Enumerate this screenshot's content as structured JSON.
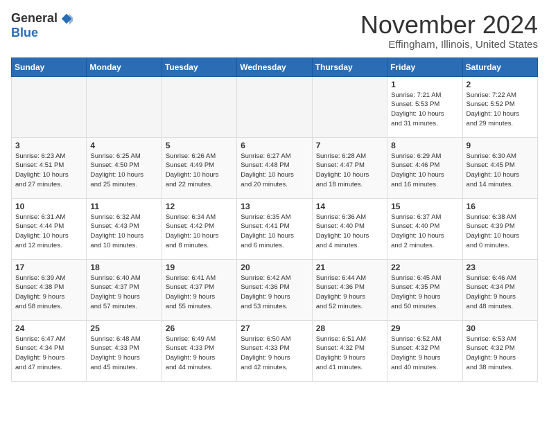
{
  "header": {
    "logo_general": "General",
    "logo_blue": "Blue",
    "month": "November 2024",
    "location": "Effingham, Illinois, United States"
  },
  "weekdays": [
    "Sunday",
    "Monday",
    "Tuesday",
    "Wednesday",
    "Thursday",
    "Friday",
    "Saturday"
  ],
  "weeks": [
    [
      {
        "day": "",
        "info": ""
      },
      {
        "day": "",
        "info": ""
      },
      {
        "day": "",
        "info": ""
      },
      {
        "day": "",
        "info": ""
      },
      {
        "day": "",
        "info": ""
      },
      {
        "day": "1",
        "info": "Sunrise: 7:21 AM\nSunset: 5:53 PM\nDaylight: 10 hours\nand 31 minutes."
      },
      {
        "day": "2",
        "info": "Sunrise: 7:22 AM\nSunset: 5:52 PM\nDaylight: 10 hours\nand 29 minutes."
      }
    ],
    [
      {
        "day": "3",
        "info": "Sunrise: 6:23 AM\nSunset: 4:51 PM\nDaylight: 10 hours\nand 27 minutes."
      },
      {
        "day": "4",
        "info": "Sunrise: 6:25 AM\nSunset: 4:50 PM\nDaylight: 10 hours\nand 25 minutes."
      },
      {
        "day": "5",
        "info": "Sunrise: 6:26 AM\nSunset: 4:49 PM\nDaylight: 10 hours\nand 22 minutes."
      },
      {
        "day": "6",
        "info": "Sunrise: 6:27 AM\nSunset: 4:48 PM\nDaylight: 10 hours\nand 20 minutes."
      },
      {
        "day": "7",
        "info": "Sunrise: 6:28 AM\nSunset: 4:47 PM\nDaylight: 10 hours\nand 18 minutes."
      },
      {
        "day": "8",
        "info": "Sunrise: 6:29 AM\nSunset: 4:46 PM\nDaylight: 10 hours\nand 16 minutes."
      },
      {
        "day": "9",
        "info": "Sunrise: 6:30 AM\nSunset: 4:45 PM\nDaylight: 10 hours\nand 14 minutes."
      }
    ],
    [
      {
        "day": "10",
        "info": "Sunrise: 6:31 AM\nSunset: 4:44 PM\nDaylight: 10 hours\nand 12 minutes."
      },
      {
        "day": "11",
        "info": "Sunrise: 6:32 AM\nSunset: 4:43 PM\nDaylight: 10 hours\nand 10 minutes."
      },
      {
        "day": "12",
        "info": "Sunrise: 6:34 AM\nSunset: 4:42 PM\nDaylight: 10 hours\nand 8 minutes."
      },
      {
        "day": "13",
        "info": "Sunrise: 6:35 AM\nSunset: 4:41 PM\nDaylight: 10 hours\nand 6 minutes."
      },
      {
        "day": "14",
        "info": "Sunrise: 6:36 AM\nSunset: 4:40 PM\nDaylight: 10 hours\nand 4 minutes."
      },
      {
        "day": "15",
        "info": "Sunrise: 6:37 AM\nSunset: 4:40 PM\nDaylight: 10 hours\nand 2 minutes."
      },
      {
        "day": "16",
        "info": "Sunrise: 6:38 AM\nSunset: 4:39 PM\nDaylight: 10 hours\nand 0 minutes."
      }
    ],
    [
      {
        "day": "17",
        "info": "Sunrise: 6:39 AM\nSunset: 4:38 PM\nDaylight: 9 hours\nand 58 minutes."
      },
      {
        "day": "18",
        "info": "Sunrise: 6:40 AM\nSunset: 4:37 PM\nDaylight: 9 hours\nand 57 minutes."
      },
      {
        "day": "19",
        "info": "Sunrise: 6:41 AM\nSunset: 4:37 PM\nDaylight: 9 hours\nand 55 minutes."
      },
      {
        "day": "20",
        "info": "Sunrise: 6:42 AM\nSunset: 4:36 PM\nDaylight: 9 hours\nand 53 minutes."
      },
      {
        "day": "21",
        "info": "Sunrise: 6:44 AM\nSunset: 4:36 PM\nDaylight: 9 hours\nand 52 minutes."
      },
      {
        "day": "22",
        "info": "Sunrise: 6:45 AM\nSunset: 4:35 PM\nDaylight: 9 hours\nand 50 minutes."
      },
      {
        "day": "23",
        "info": "Sunrise: 6:46 AM\nSunset: 4:34 PM\nDaylight: 9 hours\nand 48 minutes."
      }
    ],
    [
      {
        "day": "24",
        "info": "Sunrise: 6:47 AM\nSunset: 4:34 PM\nDaylight: 9 hours\nand 47 minutes."
      },
      {
        "day": "25",
        "info": "Sunrise: 6:48 AM\nSunset: 4:33 PM\nDaylight: 9 hours\nand 45 minutes."
      },
      {
        "day": "26",
        "info": "Sunrise: 6:49 AM\nSunset: 4:33 PM\nDaylight: 9 hours\nand 44 minutes."
      },
      {
        "day": "27",
        "info": "Sunrise: 6:50 AM\nSunset: 4:33 PM\nDaylight: 9 hours\nand 42 minutes."
      },
      {
        "day": "28",
        "info": "Sunrise: 6:51 AM\nSunset: 4:32 PM\nDaylight: 9 hours\nand 41 minutes."
      },
      {
        "day": "29",
        "info": "Sunrise: 6:52 AM\nSunset: 4:32 PM\nDaylight: 9 hours\nand 40 minutes."
      },
      {
        "day": "30",
        "info": "Sunrise: 6:53 AM\nSunset: 4:32 PM\nDaylight: 9 hours\nand 38 minutes."
      }
    ]
  ]
}
